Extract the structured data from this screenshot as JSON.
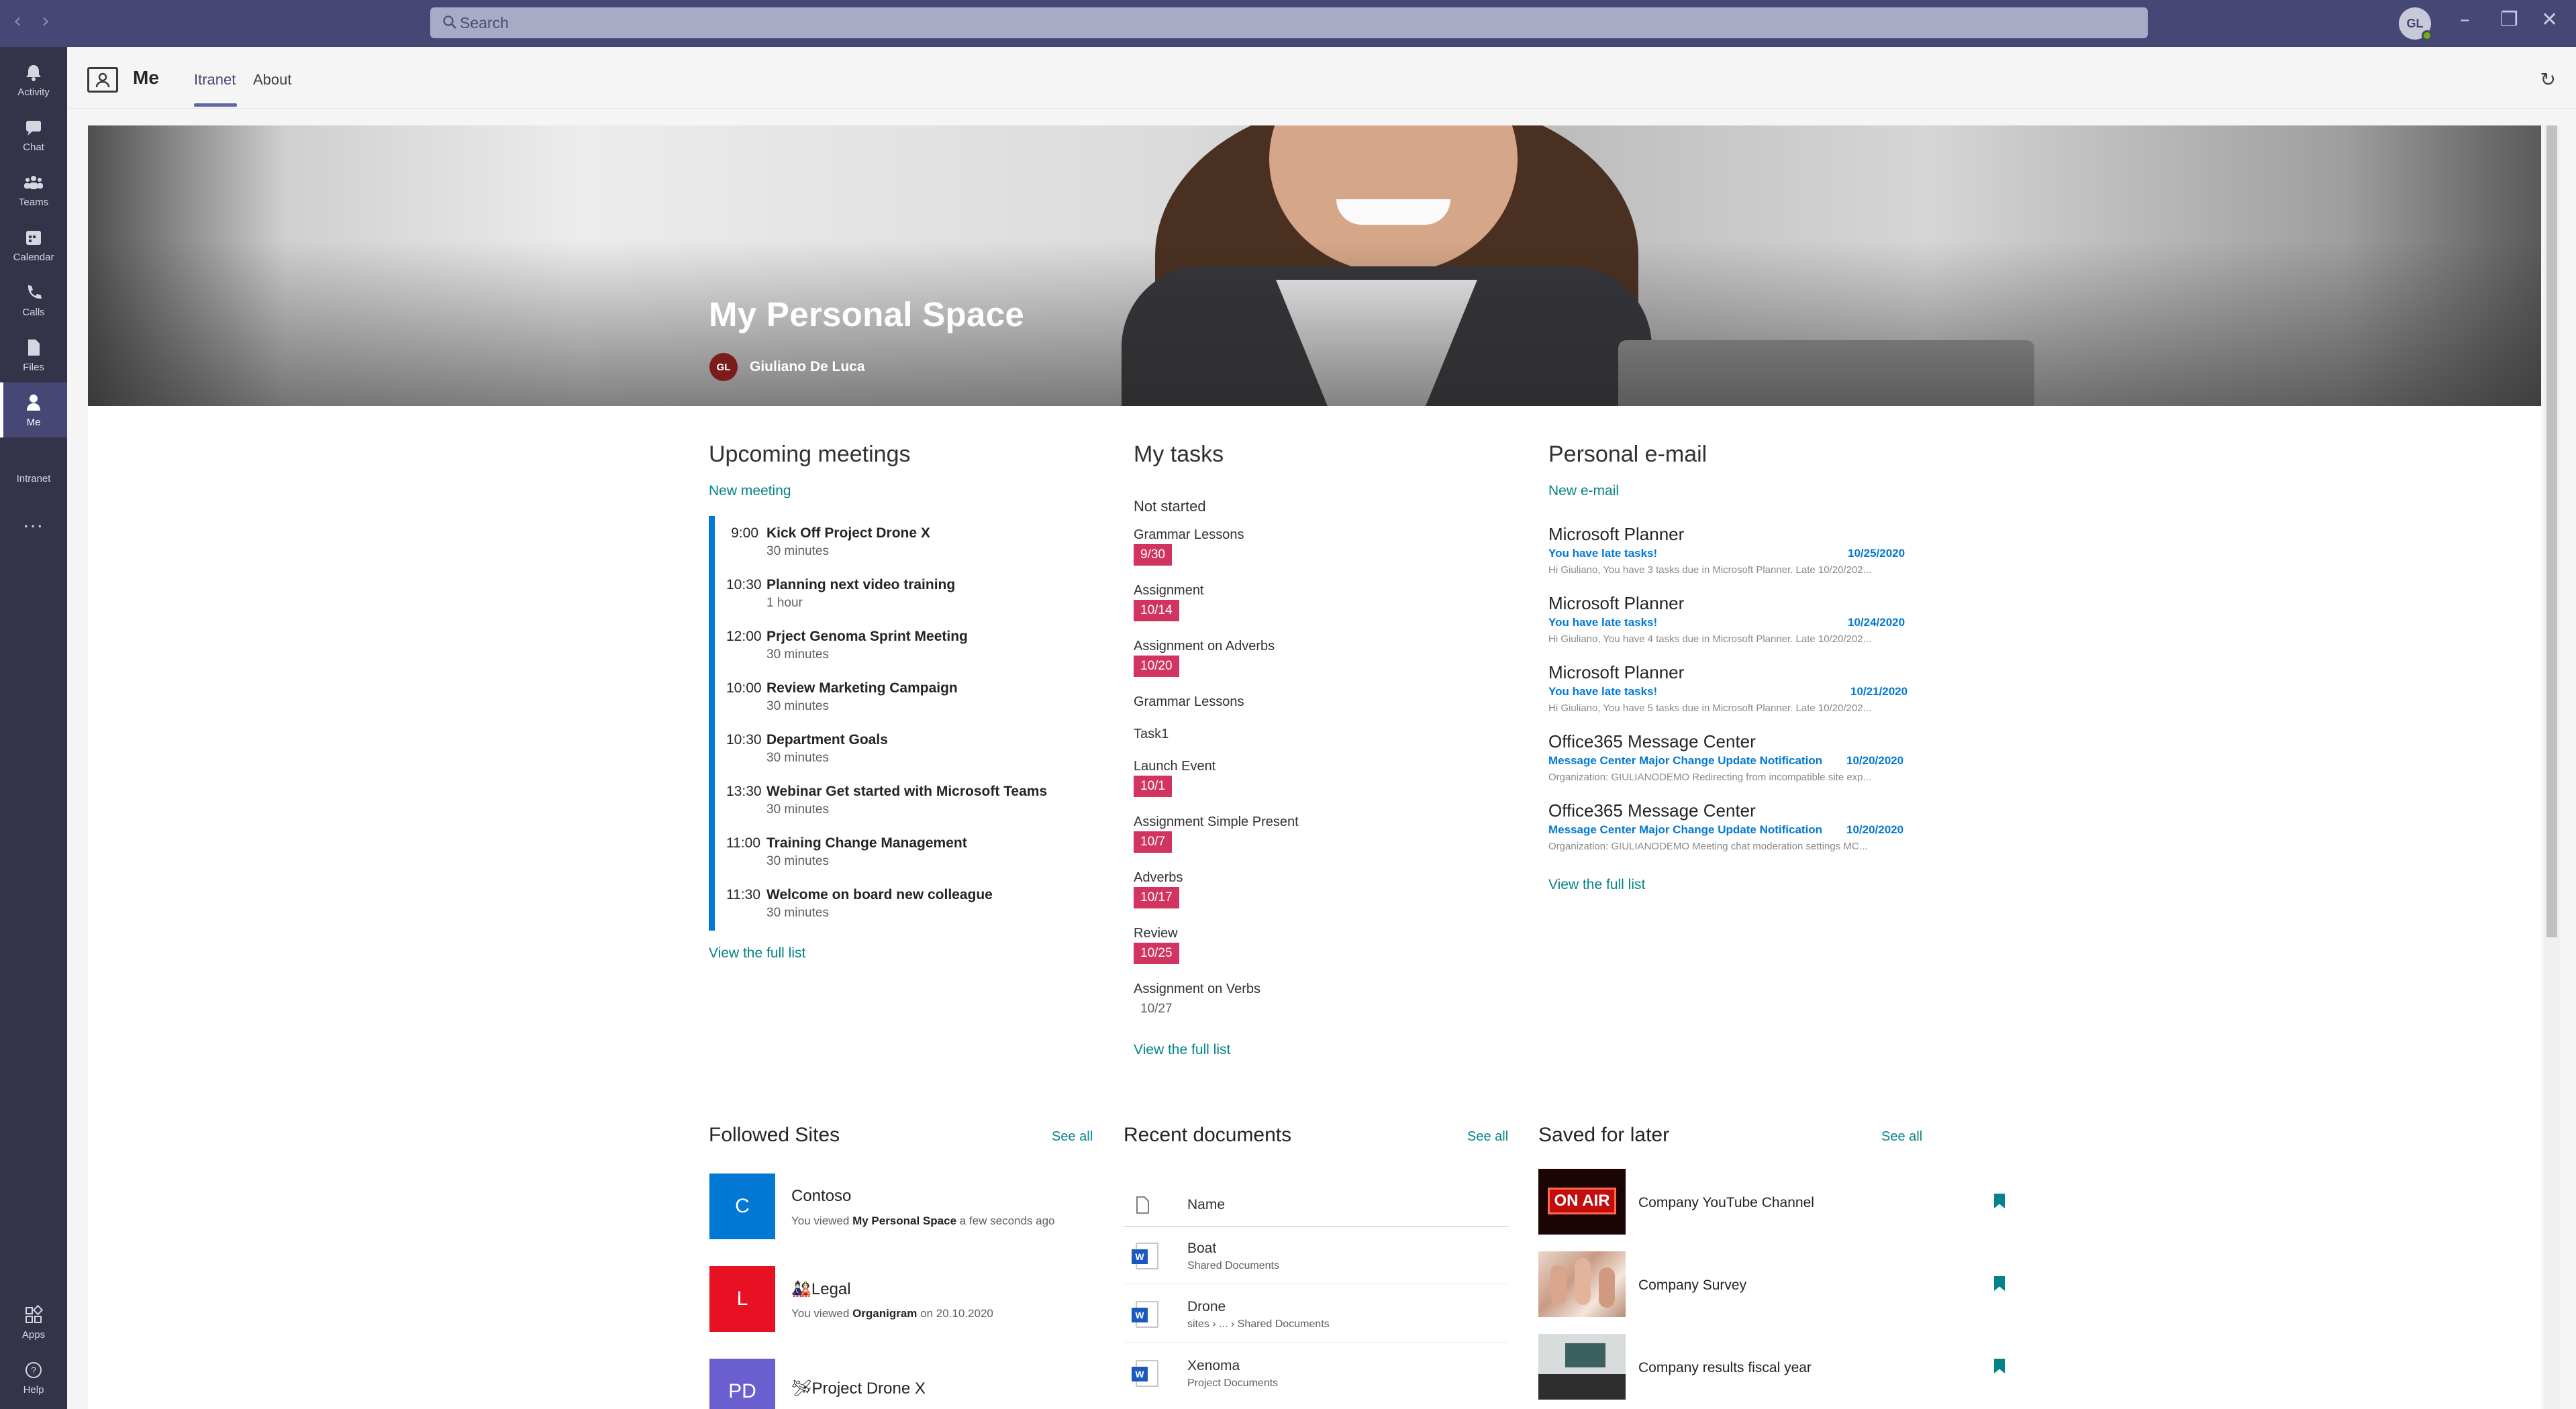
{
  "titlebar": {
    "search_placeholder": "Search",
    "avatar_initials": "GL"
  },
  "rail": {
    "items": [
      {
        "label": "Activity",
        "icon": "bell-icon"
      },
      {
        "label": "Chat",
        "icon": "chat-icon"
      },
      {
        "label": "Teams",
        "icon": "teams-icon"
      },
      {
        "label": "Calendar",
        "icon": "calendar-icon"
      },
      {
        "label": "Calls",
        "icon": "phone-icon"
      },
      {
        "label": "Files",
        "icon": "file-icon"
      },
      {
        "label": "Me",
        "icon": "person-icon"
      }
    ],
    "extra_label": "Intranet",
    "more": "...",
    "apps_label": "Apps",
    "help_label": "Help"
  },
  "app": {
    "title": "Me",
    "tabs": [
      "Itranet",
      "About"
    ],
    "active_tab": "Itranet"
  },
  "hero": {
    "title": "My Personal Space",
    "user_initials": "GL",
    "user_name": "Giuliano De Luca"
  },
  "meetings": {
    "title": "Upcoming meetings",
    "new_link": "New meeting",
    "items": [
      {
        "time": "9:00",
        "title": "Kick Off Project Drone X",
        "duration": "30 minutes"
      },
      {
        "time": "10:30",
        "title": "Planning next video training",
        "duration": "1 hour"
      },
      {
        "time": "12:00",
        "title": "Prject Genoma Sprint Meeting",
        "duration": "30 minutes"
      },
      {
        "time": "10:00",
        "title": "Review Marketing Campaign",
        "duration": "30 minutes"
      },
      {
        "time": "10:30",
        "title": "Department Goals",
        "duration": "30 minutes"
      },
      {
        "time": "13:30",
        "title": "Webinar Get started with Microsoft Teams",
        "duration": "30 minutes"
      },
      {
        "time": "11:00",
        "title": "Training Change Management",
        "duration": "30 minutes"
      },
      {
        "time": "11:30",
        "title": "Welcome on board new colleague",
        "duration": "30 minutes"
      }
    ],
    "view_full": "View the full list"
  },
  "tasks": {
    "title": "My tasks",
    "group": "Not started",
    "items": [
      {
        "name": "Grammar Lessons",
        "due": "9/30",
        "overdue": true
      },
      {
        "name": "Assignment",
        "due": "10/14",
        "overdue": true
      },
      {
        "name": "Assignment on Adverbs",
        "due": "10/20",
        "overdue": true
      },
      {
        "name": "Grammar Lessons",
        "due": "",
        "overdue": false
      },
      {
        "name": "Task1",
        "due": "",
        "overdue": false
      },
      {
        "name": "Launch Event",
        "due": "10/1",
        "overdue": true
      },
      {
        "name": "Assignment Simple Present",
        "due": "10/7",
        "overdue": true
      },
      {
        "name": "Adverbs",
        "due": "10/17",
        "overdue": true
      },
      {
        "name": "Review",
        "due": "10/25",
        "overdue": true
      },
      {
        "name": "Assignment on Verbs",
        "due": "10/27",
        "overdue": false
      }
    ],
    "view_full": "View the full list"
  },
  "email": {
    "title": "Personal e-mail",
    "new_link": "New e-mail",
    "items": [
      {
        "from": "Microsoft Planner",
        "subject": "You have late tasks!",
        "date": "10/25/2020",
        "preview": "Hi Giuliano, You have 3 tasks due in Microsoft Planner. Late 10/20/202..."
      },
      {
        "from": "Microsoft Planner",
        "subject": "You have late tasks!",
        "date": "10/24/2020",
        "preview": "Hi Giuliano, You have 4 tasks due in Microsoft Planner. Late 10/20/202..."
      },
      {
        "from": "Microsoft Planner",
        "subject": "You have late tasks!",
        "date": "10/21/2020",
        "preview": "Hi Giuliano, You have 5 tasks due in Microsoft Planner. Late 10/20/202..."
      },
      {
        "from": "Office365 Message Center",
        "subject": "Message Center Major Change Update Notification",
        "date": "10/20/2020",
        "preview": "Organization: GIULIANODEMO Redirecting from incompatible site exp..."
      },
      {
        "from": "Office365 Message Center",
        "subject": "Message Center Major Change Update Notification",
        "date": "10/20/2020",
        "preview": "Organization: GIULIANODEMO Meeting chat moderation settings MC..."
      }
    ],
    "view_full": "View the full list"
  },
  "followed": {
    "title": "Followed Sites",
    "see_all": "See all",
    "items": [
      {
        "initials": "C",
        "color": "#0078d4",
        "name": "Contoso",
        "viewed_prefix": "You viewed ",
        "viewed_page": "My Personal Space",
        "viewed_when": " a few seconds ago"
      },
      {
        "initials": "L",
        "color": "#e81123",
        "name": "🎎Legal",
        "viewed_prefix": "You viewed ",
        "viewed_page": "Organigram",
        "viewed_when": " on 20.10.2020"
      },
      {
        "initials": "PD",
        "color": "#6b5fcf",
        "name": "🛩Project Drone X",
        "viewed_prefix": "",
        "viewed_page": "",
        "viewed_when": ""
      }
    ]
  },
  "recent_docs": {
    "title": "Recent documents",
    "see_all": "See all",
    "column_name": "Name",
    "items": [
      {
        "name": "Boat",
        "path": "Shared Documents"
      },
      {
        "name": "Drone",
        "path": "sites › ... › Shared Documents"
      },
      {
        "name": "Xenoma",
        "path": "Project Documents"
      }
    ]
  },
  "saved": {
    "title": "Saved for later",
    "see_all": "See all",
    "items": [
      {
        "name": "Company YouTube Channel",
        "thumb_text": "ON AIR"
      },
      {
        "name": "Company Survey",
        "thumb_text": ""
      },
      {
        "name": "Company results fiscal year",
        "thumb_text": ""
      }
    ]
  },
  "colors": {
    "rail_bg": "#33344a",
    "titlebar_bg": "#464775",
    "accent": "#6264a7",
    "link": "#038387",
    "overdue": "#d13461",
    "meeting_bar": "#0078d4"
  }
}
